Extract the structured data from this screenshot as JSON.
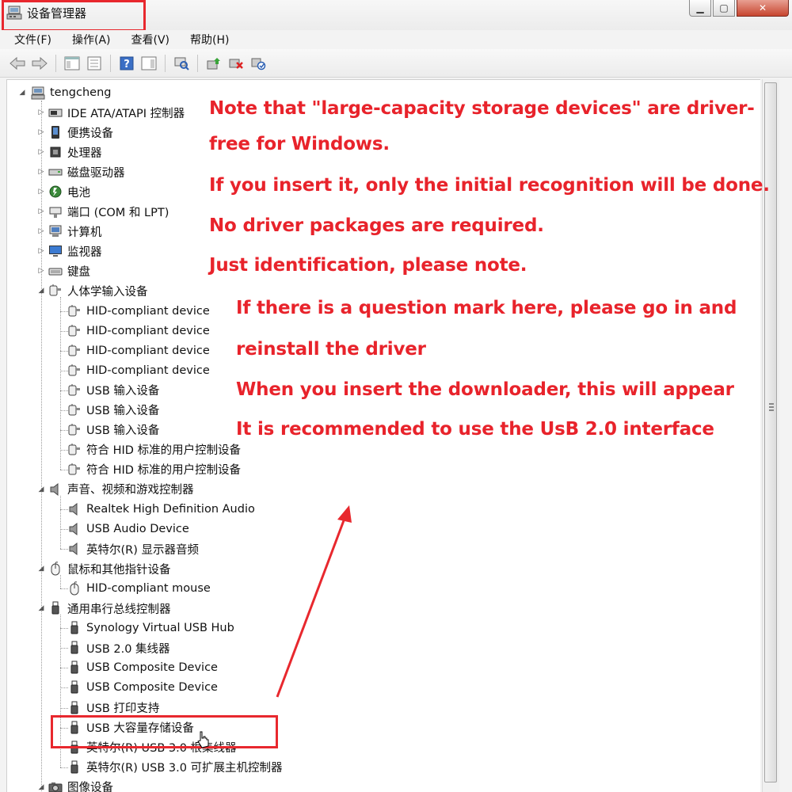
{
  "window": {
    "title": "设备管理器",
    "buttons": {
      "minimize": "▁",
      "maximize": "▢",
      "close": "✕"
    }
  },
  "menu": {
    "items": [
      "文件(F)",
      "操作(A)",
      "查看(V)",
      "帮助(H)"
    ]
  },
  "toolbar": {
    "icons": [
      "back-icon",
      "forward-icon",
      "console-tree-icon",
      "properties-icon",
      "help-icon",
      "action-pane-icon",
      "scan-hardware-icon",
      "update-driver-icon",
      "uninstall-icon",
      "disable-icon"
    ]
  },
  "tree": {
    "root": "tengcheng",
    "nodes": [
      {
        "label": "IDE ATA/ATAPI 控制器",
        "level": 1,
        "state": "collapsed",
        "icon": "ide-controller-icon"
      },
      {
        "label": "便携设备",
        "level": 1,
        "state": "collapsed",
        "icon": "portable-device-icon"
      },
      {
        "label": "处理器",
        "level": 1,
        "state": "collapsed",
        "icon": "processor-icon"
      },
      {
        "label": "磁盘驱动器",
        "level": 1,
        "state": "collapsed",
        "icon": "disk-drive-icon"
      },
      {
        "label": "电池",
        "level": 1,
        "state": "collapsed",
        "icon": "battery-icon"
      },
      {
        "label": "端口 (COM 和 LPT)",
        "level": 1,
        "state": "collapsed",
        "icon": "port-icon"
      },
      {
        "label": "计算机",
        "level": 1,
        "state": "collapsed",
        "icon": "computer-icon"
      },
      {
        "label": "监视器",
        "level": 1,
        "state": "collapsed",
        "icon": "monitor-icon"
      },
      {
        "label": "键盘",
        "level": 1,
        "state": "collapsed",
        "icon": "keyboard-icon"
      },
      {
        "label": "人体学输入设备",
        "level": 1,
        "state": "expanded",
        "icon": "hid-icon"
      },
      {
        "label": "HID-compliant device",
        "level": 2,
        "icon": "hid-icon"
      },
      {
        "label": "HID-compliant device",
        "level": 2,
        "icon": "hid-icon"
      },
      {
        "label": "HID-compliant device",
        "level": 2,
        "icon": "hid-icon"
      },
      {
        "label": "HID-compliant device",
        "level": 2,
        "icon": "hid-icon"
      },
      {
        "label": "USB 输入设备",
        "level": 2,
        "icon": "hid-icon"
      },
      {
        "label": "USB 输入设备",
        "level": 2,
        "icon": "hid-icon"
      },
      {
        "label": "USB 输入设备",
        "level": 2,
        "icon": "hid-icon"
      },
      {
        "label": "符合 HID 标准的用户控制设备",
        "level": 2,
        "icon": "hid-icon"
      },
      {
        "label": "符合 HID 标准的用户控制设备",
        "level": 2,
        "icon": "hid-icon"
      },
      {
        "label": "声音、视频和游戏控制器",
        "level": 1,
        "state": "expanded",
        "icon": "speaker-icon"
      },
      {
        "label": "Realtek High Definition Audio",
        "level": 2,
        "icon": "speaker-icon"
      },
      {
        "label": "USB Audio Device",
        "level": 2,
        "icon": "speaker-icon"
      },
      {
        "label": "英特尔(R) 显示器音频",
        "level": 2,
        "icon": "speaker-icon"
      },
      {
        "label": "鼠标和其他指针设备",
        "level": 1,
        "state": "expanded",
        "icon": "mouse-icon"
      },
      {
        "label": "HID-compliant mouse",
        "level": 2,
        "icon": "mouse-icon"
      },
      {
        "label": "通用串行总线控制器",
        "level": 1,
        "state": "expanded",
        "icon": "usb-icon"
      },
      {
        "label": "Synology Virtual USB Hub",
        "level": 2,
        "icon": "usb-icon"
      },
      {
        "label": "USB 2.0 集线器",
        "level": 2,
        "icon": "usb-icon"
      },
      {
        "label": "USB Composite Device",
        "level": 2,
        "icon": "usb-icon"
      },
      {
        "label": "USB Composite Device",
        "level": 2,
        "icon": "usb-icon"
      },
      {
        "label": "USB 打印支持",
        "level": 2,
        "icon": "usb-icon"
      },
      {
        "label": "USB 大容量存储设备",
        "level": 2,
        "icon": "usb-icon",
        "highlighted": true
      },
      {
        "label": "英特尔(R) USB 3.0 根集线器",
        "level": 2,
        "icon": "usb-icon"
      },
      {
        "label": "英特尔(R) USB 3.0 可扩展主机控制器",
        "level": 2,
        "icon": "usb-icon"
      },
      {
        "label": "图像设备",
        "level": 1,
        "state": "expanded",
        "icon": "camera-icon"
      }
    ]
  },
  "annotations": {
    "lines": [
      "Note that \"large-capacity storage devices\" are driver-",
      "free for Windows.",
      "If you insert it, only the initial recognition will be done.",
      "No driver packages are required.",
      "Just identification, please note.",
      "If there is a question mark here, please go in and",
      "reinstall the driver",
      "When you insert the downloader, this will appear",
      "It is recommended to use the UsB 2.0 interface"
    ],
    "color": "#e8232b"
  }
}
